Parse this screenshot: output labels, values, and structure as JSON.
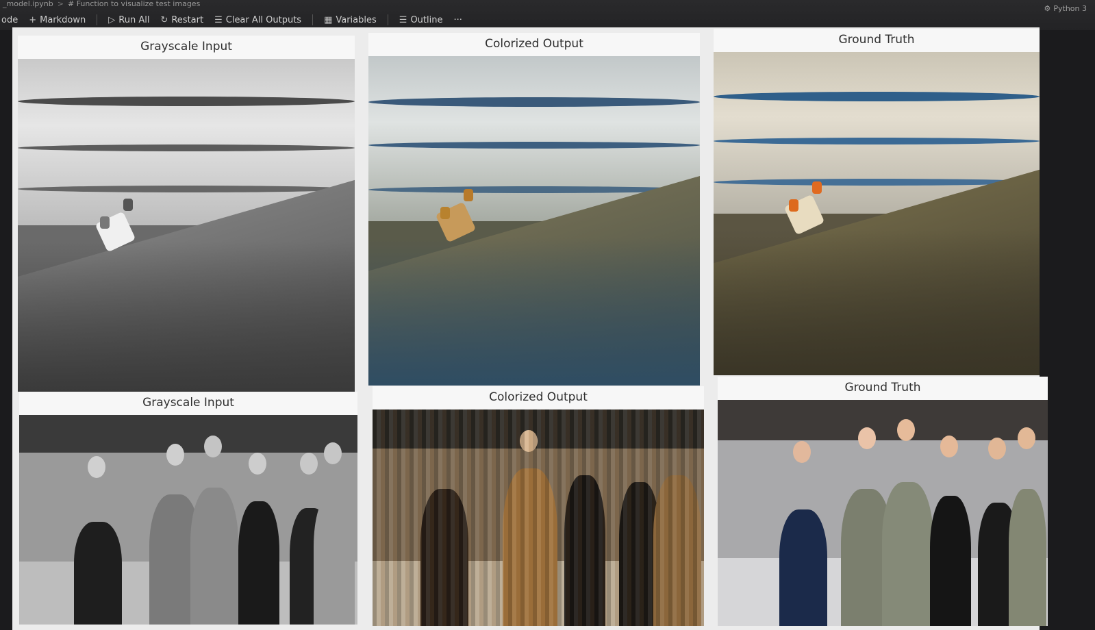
{
  "breadcrumb": {
    "file": "_model.ipynb",
    "separator": ">",
    "cell": "# Function to visualize test images"
  },
  "toolbar": {
    "code_label": "ode",
    "markdown_label": "Markdown",
    "run_all_label": "Run All",
    "restart_label": "Restart",
    "clear_label": "Clear All Outputs",
    "variables_label": "Variables",
    "outline_label": "Outline",
    "more_label": "···"
  },
  "kernel": {
    "label": "Python 3"
  },
  "rows": [
    {
      "titles": [
        "Grayscale Input",
        "Colorized Output",
        "Ground Truth"
      ],
      "scene": "beach"
    },
    {
      "titles": [
        "Grayscale Input",
        "Colorized Output",
        "Ground Truth"
      ],
      "scene": "people"
    }
  ],
  "colors": {
    "toolbar_bg": "#252527",
    "panel_bg": "#f7f7f7",
    "title_color": "#2e2e2e"
  }
}
